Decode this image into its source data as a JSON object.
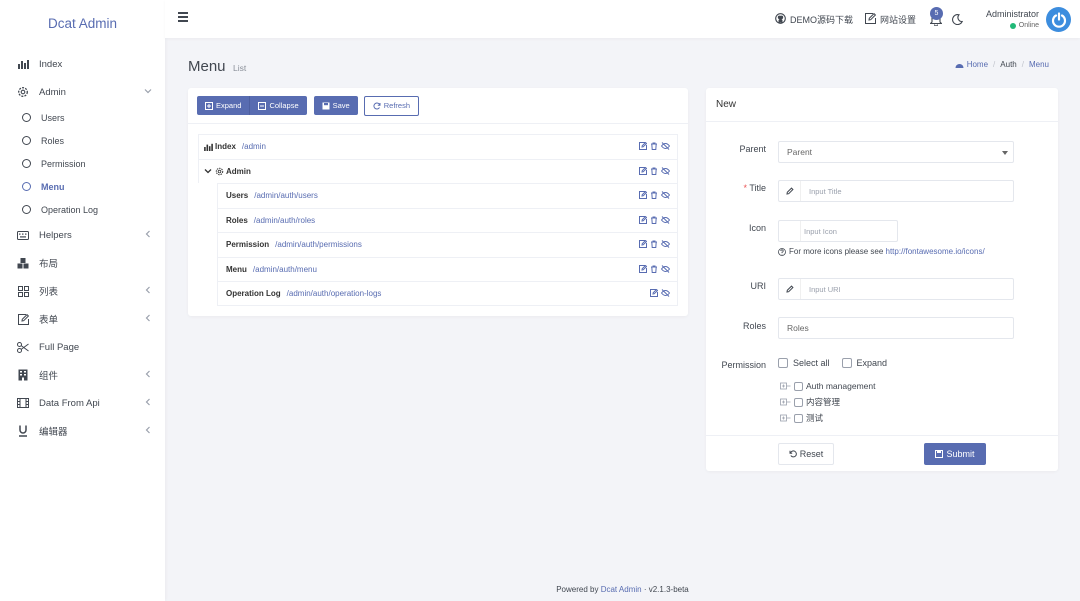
{
  "app": {
    "title": "Dcat Admin"
  },
  "sidebar": {
    "items": [
      {
        "label": "Index",
        "icon": "bar-chart-icon"
      },
      {
        "label": "Admin",
        "icon": "gear-icon"
      },
      {
        "label": "Helpers",
        "icon": "keyboard-icon"
      },
      {
        "label": "布局",
        "icon": "cubes-icon"
      },
      {
        "label": "列表",
        "icon": "grid-icon"
      },
      {
        "label": "表单",
        "icon": "edit-icon"
      },
      {
        "label": "Full Page",
        "icon": "scissors-icon"
      },
      {
        "label": "组件",
        "icon": "building-icon"
      },
      {
        "label": "Data From Api",
        "icon": "film-icon"
      },
      {
        "label": "编辑器",
        "icon": "underline-icon"
      }
    ],
    "admin_children": [
      {
        "label": "Users"
      },
      {
        "label": "Roles"
      },
      {
        "label": "Permission"
      },
      {
        "label": "Menu"
      },
      {
        "label": "Operation Log"
      }
    ]
  },
  "topbar": {
    "demo_label": "DEMO源码下载",
    "settings_label": "网站设置",
    "notification_count": "5",
    "user_name": "Administrator",
    "user_status": "Online"
  },
  "header": {
    "title": "Menu",
    "subtitle": "List",
    "breadcrumb": [
      "Home",
      "Auth",
      "Menu"
    ]
  },
  "tree_panel": {
    "expand_label": "Expand",
    "collapse_label": "Collapse",
    "save_label": "Save",
    "refresh_label": "Refresh",
    "rows": [
      {
        "title": "Index",
        "uri": "/admin"
      },
      {
        "title": "Admin",
        "uri": ""
      },
      {
        "title": "Users",
        "uri": "/admin/auth/users"
      },
      {
        "title": "Roles",
        "uri": "/admin/auth/roles"
      },
      {
        "title": "Permission",
        "uri": "/admin/auth/permissions"
      },
      {
        "title": "Menu",
        "uri": "/admin/auth/menu"
      },
      {
        "title": "Operation Log",
        "uri": "/admin/auth/operation-logs"
      }
    ]
  },
  "form": {
    "heading": "New",
    "parent_label": "Parent",
    "parent_value": "Parent",
    "title_label": "Title",
    "title_required_mark": "*",
    "title_placeholder": "Input Title",
    "icon_label": "Icon",
    "icon_placeholder": "Input Icon",
    "icon_help": "For more icons please see",
    "icon_help_link": "http://fontawesome.io/icons/",
    "uri_label": "URI",
    "uri_placeholder": "Input URI",
    "roles_label": "Roles",
    "roles_value": "Roles",
    "permission_label": "Permission",
    "select_all_label": "Select all",
    "expand_label": "Expand",
    "permission_items": [
      "Auth management",
      "内容管理",
      "测试"
    ],
    "reset_label": "Reset",
    "submit_label": "Submit"
  },
  "footer": {
    "prefix": "Powered by",
    "link": "Dcat Admin",
    "version": "· v2.1.3-beta"
  },
  "colors": {
    "primary": "#586cb1",
    "online": "#21b978",
    "avatar": "#3c8dde"
  }
}
